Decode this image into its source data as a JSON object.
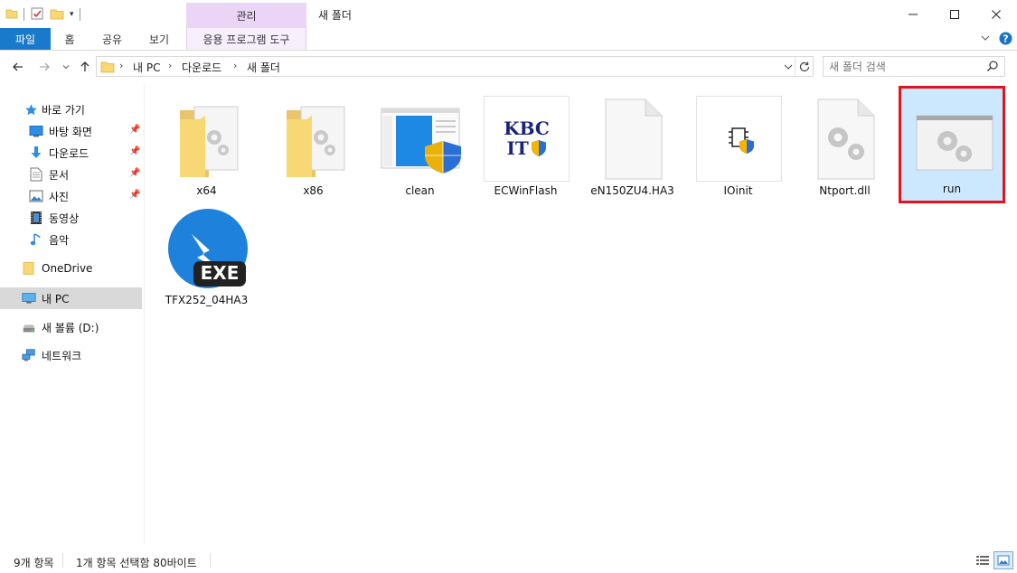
{
  "window": {
    "title": "새 폴더",
    "context_tab_group": "관리"
  },
  "ribbon": {
    "tabs": [
      {
        "label": "파일"
      },
      {
        "label": "홈"
      },
      {
        "label": "공유"
      },
      {
        "label": "보기"
      },
      {
        "label": "응용 프로그램 도구"
      }
    ]
  },
  "address": {
    "crumbs": [
      "내 PC",
      "다운로드",
      "새 폴더"
    ]
  },
  "search": {
    "placeholder": "새 폴더 검색"
  },
  "nav": {
    "quick_access": "바로 가기",
    "pinned": [
      {
        "label": "바탕 화면",
        "icon": "desktop-icon"
      },
      {
        "label": "다운로드",
        "icon": "download-icon"
      },
      {
        "label": "문서",
        "icon": "document-icon"
      },
      {
        "label": "사진",
        "icon": "picture-icon"
      }
    ],
    "others": [
      {
        "label": "동영상",
        "icon": "video-icon"
      },
      {
        "label": "음악",
        "icon": "music-icon"
      }
    ],
    "onedrive": "OneDrive",
    "this_pc": "내 PC",
    "drive": "새 볼륨 (D:)",
    "network": "네트워크"
  },
  "files": [
    {
      "name": "x64",
      "icon": "folder-gear-icon"
    },
    {
      "name": "x86",
      "icon": "folder-gear-icon"
    },
    {
      "name": "clean",
      "icon": "app-shield-icon"
    },
    {
      "name": "ECWinFlash",
      "icon": "kbc-it-icon",
      "logo_text_1": "KBC",
      "logo_text_2": "IT"
    },
    {
      "name": "eN150ZU4.HA3",
      "icon": "blank-file-icon"
    },
    {
      "name": "IOinit",
      "icon": "chip-shield-icon"
    },
    {
      "name": "Ntport.dll",
      "icon": "dll-gear-icon"
    },
    {
      "name": "run",
      "icon": "window-gear-icon",
      "selected": true
    },
    {
      "name": "TFX252_04HA3",
      "icon": "exe-badge-icon",
      "badge": "EXE"
    }
  ],
  "status": {
    "count": "9개 항목",
    "selection": "1개 항목 선택함 80바이트"
  },
  "colors": {
    "file_tab": "#1979ca",
    "manage_tab": "#ebd5f7",
    "selection_bg": "#cce8ff",
    "highlight_border": "#e1141e"
  }
}
